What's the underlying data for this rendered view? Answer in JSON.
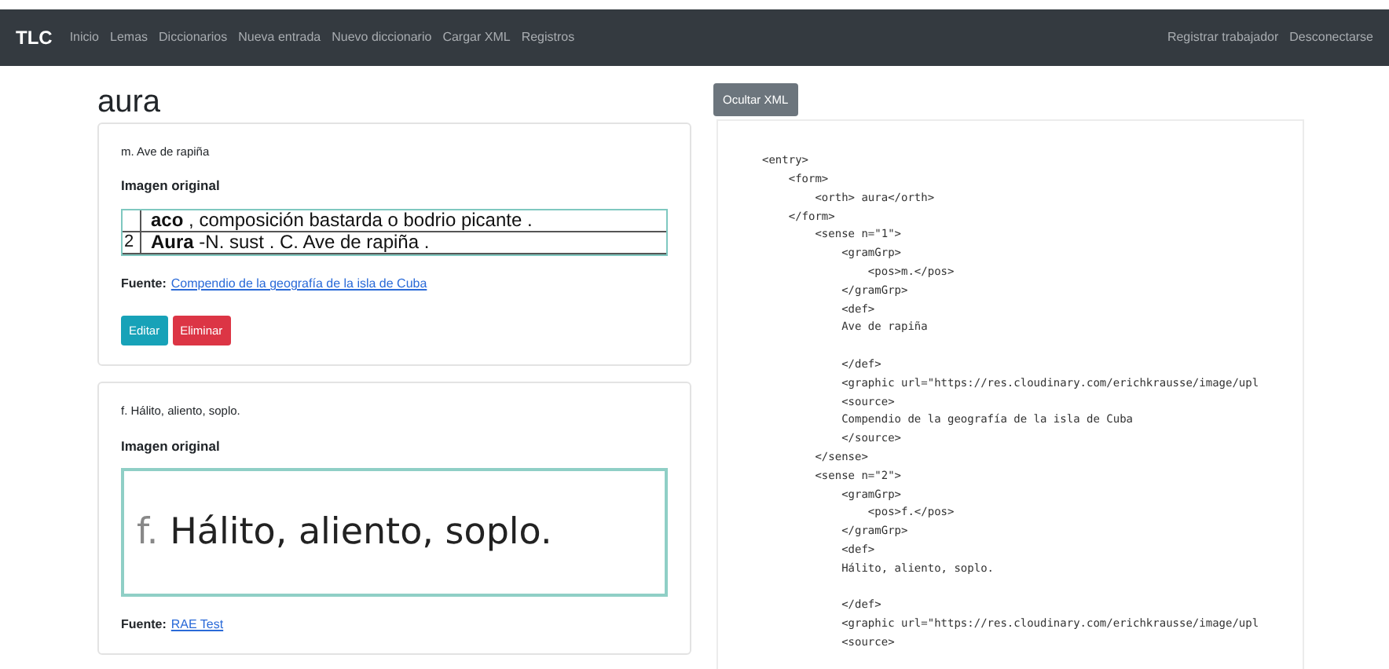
{
  "navbar": {
    "brand": "TLC",
    "links": [
      "Inicio",
      "Lemas",
      "Diccionarios",
      "Nueva entrada",
      "Nuevo diccionario",
      "Cargar XML",
      "Registros"
    ],
    "right_links": [
      "Registrar trabajador",
      "Desconectarse"
    ]
  },
  "entry": {
    "title": "aura",
    "senses": [
      {
        "definition": "m. Ave de rapiña",
        "image_heading": "Imagen original",
        "image": {
          "kind": "scan",
          "lines": [
            {
              "headword": "aco",
              "rest": " , composición bastarda o bodrio picante ."
            },
            {
              "number": "2",
              "headword": "Aura",
              "rest": " -N. sust . C. Ave de rapiña ."
            }
          ]
        },
        "source_label": "Fuente:",
        "source": "Compendio de la geografía de la isla de Cuba",
        "buttons": [
          {
            "label": "Editar",
            "kind": "info"
          },
          {
            "label": "Eliminar",
            "kind": "danger"
          }
        ]
      },
      {
        "definition": "f. Hálito, aliento, soplo.",
        "image_heading": "Imagen original",
        "image": {
          "kind": "text",
          "pos": "f.",
          "text": "Hálito, aliento, soplo."
        },
        "source_label": "Fuente:",
        "source": "RAE Test"
      }
    ]
  },
  "xml_toggle": "Ocultar XML",
  "xml_lines": [
    {
      "text": "<entry>",
      "blank_after": false
    },
    {
      "text": "    <form>",
      "blank_after": false
    },
    {
      "text": "        <orth> aura</orth>",
      "blank_after": false
    },
    {
      "text": "    </form>",
      "blank_after": false
    },
    {
      "text": "        <sense n=\"1\">",
      "blank_after": false
    },
    {
      "text": "            <gramGrp>",
      "blank_after": false
    },
    {
      "text": "                <pos>m.</pos>",
      "blank_after": false
    },
    {
      "text": "            </gramGrp>",
      "blank_after": false
    },
    {
      "text": "            <def>",
      "blank_after": false
    },
    {
      "text": "            Ave de rapiña",
      "blank_after": true
    },
    {
      "text": "            </def>",
      "blank_after": false
    },
    {
      "text": "            <graphic url=\"https://res.cloudinary.com/erichkrausse/image/upl",
      "blank_after": false
    },
    {
      "text": "            <source>",
      "blank_after": false
    },
    {
      "text": "            Compendio de la geografía de la isla de Cuba",
      "blank_after": false
    },
    {
      "text": "            </source>",
      "blank_after": false
    },
    {
      "text": "        </sense>",
      "blank_after": false
    },
    {
      "text": "        <sense n=\"2\">",
      "blank_after": false
    },
    {
      "text": "            <gramGrp>",
      "blank_after": false
    },
    {
      "text": "                <pos>f.</pos>",
      "blank_after": false
    },
    {
      "text": "            </gramGrp>",
      "blank_after": false
    },
    {
      "text": "            <def>",
      "blank_after": false
    },
    {
      "text": "            Hálito, aliento, soplo.",
      "blank_after": true
    },
    {
      "text": "            </def>",
      "blank_after": false
    },
    {
      "text": "            <graphic url=\"https://res.cloudinary.com/erichkrausse/image/upl",
      "blank_after": false
    },
    {
      "text": "            <source>",
      "blank_after": false
    }
  ]
}
